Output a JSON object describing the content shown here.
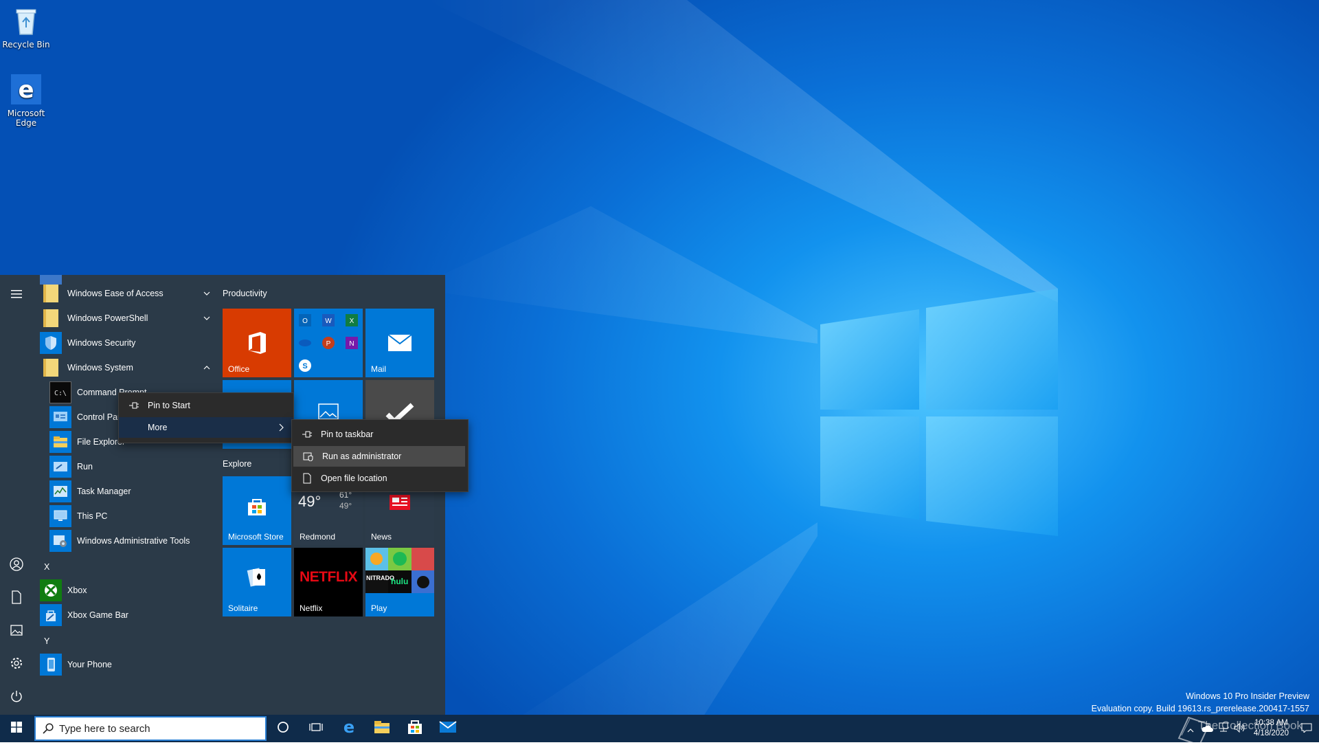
{
  "desktop": {
    "icons": [
      {
        "label": "Recycle Bin",
        "icon": "recycle-bin-icon"
      },
      {
        "label": "Microsoft Edge",
        "icon": "edge-icon"
      }
    ],
    "watermark": {
      "line1": "Windows 10 Pro Insider Preview",
      "line2": "Evaluation copy. Build 19613.rs_prerelease.200417-1557",
      "overlay": "The Collection Book"
    }
  },
  "start_menu": {
    "apps": [
      {
        "label": "Windows Ease of Access",
        "icon": "folder-icon",
        "chevron": "down"
      },
      {
        "label": "Windows PowerShell",
        "icon": "folder-icon",
        "chevron": "down"
      },
      {
        "label": "Windows Security",
        "icon": "shield-icon"
      },
      {
        "label": "Windows System",
        "icon": "folder-icon",
        "chevron": "up"
      },
      {
        "label": "Command Prompt",
        "icon": "command-prompt-icon"
      },
      {
        "label": "Control Panel",
        "icon": "control-panel-icon"
      },
      {
        "label": "File Explorer",
        "icon": "file-explorer-icon"
      },
      {
        "label": "Run",
        "icon": "run-icon"
      },
      {
        "label": "Task Manager",
        "icon": "task-manager-icon"
      },
      {
        "label": "This PC",
        "icon": "this-pc-icon"
      },
      {
        "label": "Windows Administrative Tools",
        "icon": "admin-tools-icon"
      },
      {
        "label": "Xbox",
        "icon": "xbox-icon"
      },
      {
        "label": "Xbox Game Bar",
        "icon": "game-bar-icon"
      },
      {
        "label": "Your Phone",
        "icon": "phone-icon"
      }
    ],
    "letters": [
      "X",
      "Y"
    ],
    "groups": {
      "productivity": "Productivity",
      "explore": "Explore"
    },
    "tiles": {
      "office": "Office",
      "mail": "Mail",
      "store": "Microsoft Store",
      "weather": {
        "temp": "49°",
        "high": "61°",
        "low": "49°",
        "city": "Redmond"
      },
      "news": "News",
      "solitaire": "Solitaire",
      "netflix": {
        "label": "Netflix",
        "logo": "NETFLIX"
      },
      "play": {
        "label": "Play",
        "nitrado": "NITRADO",
        "hulu": "hulu"
      }
    },
    "colors": {
      "accent": "#0078d7",
      "office": "#d83b01",
      "menu_bg": "#2b3a48"
    }
  },
  "context_menu": {
    "items": [
      {
        "label": "Pin to Start",
        "icon": "pin-icon"
      },
      {
        "label": "More",
        "icon": "",
        "submenu": true
      }
    ]
  },
  "submenu": {
    "items": [
      {
        "label": "Pin to taskbar",
        "icon": "pin-icon"
      },
      {
        "label": "Run as administrator",
        "icon": "shield-admin-icon",
        "highlighted": true
      },
      {
        "label": "Open file location",
        "icon": "file-location-icon"
      }
    ]
  },
  "taskbar": {
    "search_placeholder": "Type here to search",
    "clock": {
      "time": "10:38 AM",
      "date": "4/18/2020"
    }
  }
}
